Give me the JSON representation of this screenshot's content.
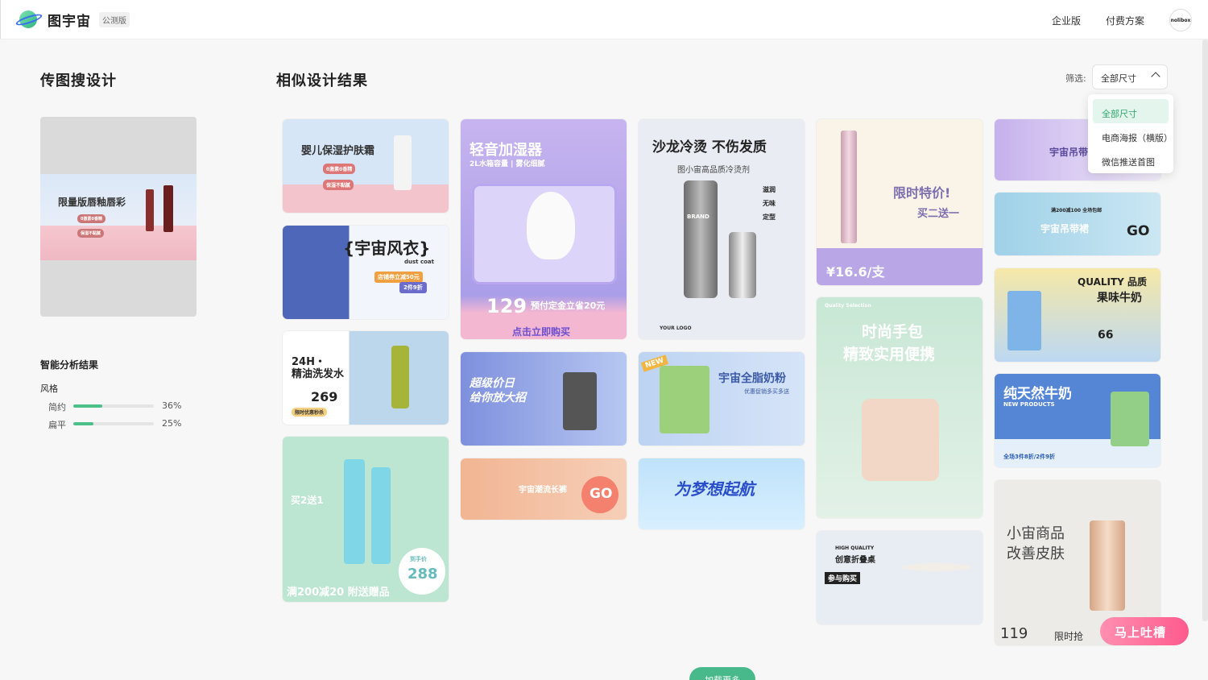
{
  "header": {
    "brand": "图宇宙",
    "beta": "公测版",
    "nav": [
      "企业版",
      "付费方案"
    ],
    "avatar_text": "nolibox"
  },
  "left": {
    "title": "传图搜设计",
    "uploaded_image": {
      "heading": "限量版唇釉唇彩",
      "tag1": "0激素0香精",
      "tag2": "保湿不黏腻"
    },
    "analysis_title": "智能分析结果",
    "style_label": "风格",
    "metrics": [
      {
        "name": "简约",
        "percent": 36,
        "label": "36%"
      },
      {
        "name": "扁平",
        "percent": 25,
        "label": "25%"
      }
    ]
  },
  "results": {
    "title": "相似设计结果",
    "filter_label": "筛选:",
    "filter_value": "全部尺寸",
    "filter_options": [
      "全部尺寸",
      "电商海报（横版）",
      "微信推送首图"
    ]
  },
  "cards": [
    {
      "id": "c1",
      "texts": [
        "婴儿保湿护肤霜",
        "0激素0香精",
        "保湿不黏腻"
      ]
    },
    {
      "id": "c2",
      "texts": [
        "{宇宙风衣}",
        "dust coat",
        "店铺券立减50元",
        "2件9折"
      ]
    },
    {
      "id": "c3",
      "texts": [
        "24H・",
        "精油洗发水",
        "269",
        "限时优惠秒杀"
      ]
    },
    {
      "id": "c4",
      "texts": [
        "买2送1",
        "满200减20 附送赠品",
        "288",
        "到手价"
      ]
    },
    {
      "id": "c5",
      "texts": [
        "轻音加湿器",
        "2L水箱容量 | 雾化细腻",
        "129",
        "预付定金立省20元",
        "点击立即购买"
      ]
    },
    {
      "id": "c6",
      "texts": [
        "超级价日",
        "给你放大招"
      ]
    },
    {
      "id": "c7",
      "texts": [
        "宇宙潮流长裤",
        "GO"
      ]
    },
    {
      "id": "c8",
      "texts": [
        "沙龙冷烫 不伤发质",
        "图小宙高品质冷烫剂",
        "滋润",
        "无味",
        "定型",
        "BRAND",
        "YOUR LOGO"
      ]
    },
    {
      "id": "c9",
      "texts": [
        "宇宙全脂奶粉",
        "优惠促销多买多送",
        "NEW"
      ]
    },
    {
      "id": "c10",
      "texts": [
        "为梦想起航"
      ]
    },
    {
      "id": "c11",
      "texts": [
        "限时特价!",
        "买二送一",
        "¥16.6/支"
      ]
    },
    {
      "id": "c12",
      "texts": [
        "Quality Selection",
        "时尚手包",
        "精致实用便携"
      ]
    },
    {
      "id": "c13",
      "texts": [
        "HIGH QUALITY",
        "创意折叠桌",
        "参与购买"
      ]
    },
    {
      "id": "c14",
      "texts": [
        "宇宙吊带"
      ]
    },
    {
      "id": "c15",
      "texts": [
        "宇宙吊带裙",
        "GO",
        "满200减100 全场包邮"
      ]
    },
    {
      "id": "c16",
      "texts": [
        "QUALITY 品质",
        "果味牛奶",
        "66"
      ]
    },
    {
      "id": "c17",
      "texts": [
        "纯天然牛奶",
        "NEW PRODUCTS",
        "全场3件8折/2件9折"
      ]
    },
    {
      "id": "c18",
      "texts": [
        "小宙商品",
        "改善皮肤",
        "119",
        "限时抢"
      ]
    }
  ],
  "load_more": "加载更多",
  "feedback": "马上吐槽",
  "colors": {
    "accent": "#48b98a",
    "active_bg": "#e3f5ec"
  }
}
